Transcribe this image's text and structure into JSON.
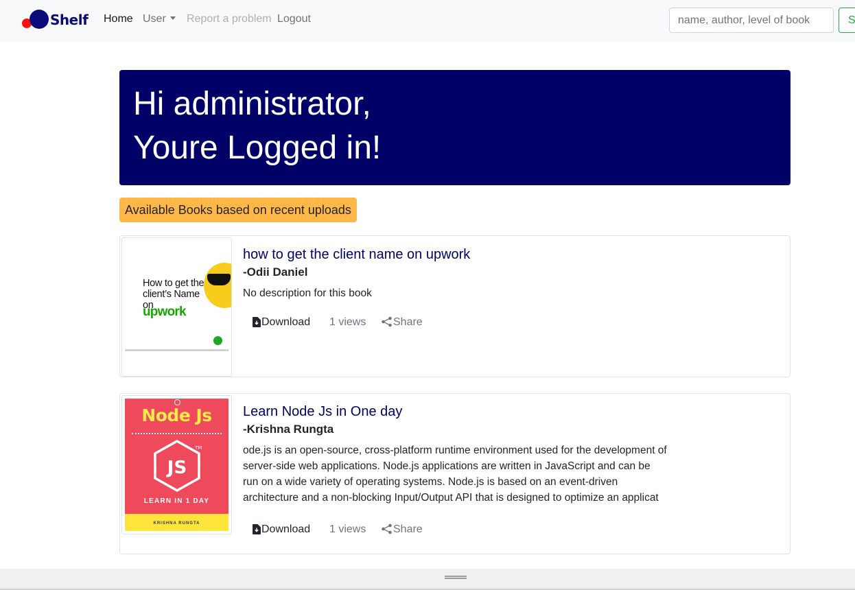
{
  "navbar": {
    "brand": "Shelf",
    "links": {
      "home": "Home",
      "user": "User",
      "report": "Report a problem",
      "logout": "Logout"
    },
    "search_placeholder": "name, author, level of book",
    "search_button": "Search"
  },
  "hero": {
    "line1": "Hi administrator,",
    "line2": "Youre Logged in!"
  },
  "section_badge": "Available Books based on recent uploads",
  "books": [
    {
      "title": "how to get the client name on upwork",
      "author": "-Odii Daniel",
      "description": "No description for this book",
      "download_label": "Download",
      "views_label": "1 views",
      "share_label": "Share",
      "cover": {
        "text": "How to get the client’s Name on",
        "brand": "upwork"
      }
    },
    {
      "title": "Learn Node Js in One day",
      "author": "-Krishna Rungta",
      "description": "ode.js is an open-source, cross-platform runtime environment used for the development of server-side web applications. Node.js applications are written in JavaScript and can be run on a wide variety of operating systems. Node.js is based on an event-driven architecture and a non-blocking Input/Output API that is designed to optimize an applicat",
      "download_label": "Download",
      "views_label": "1 views",
      "share_label": "Share",
      "cover": {
        "title": "Node Js",
        "logo": "JS",
        "subtitle": "LEARN IN 1 DAY",
        "author": "KRISHNA RUNGTA"
      }
    }
  ],
  "colors": {
    "hero_bg": "#000066",
    "badge_bg": "#ffb848",
    "title_text": "#000066",
    "search_accent": "#28a745"
  }
}
